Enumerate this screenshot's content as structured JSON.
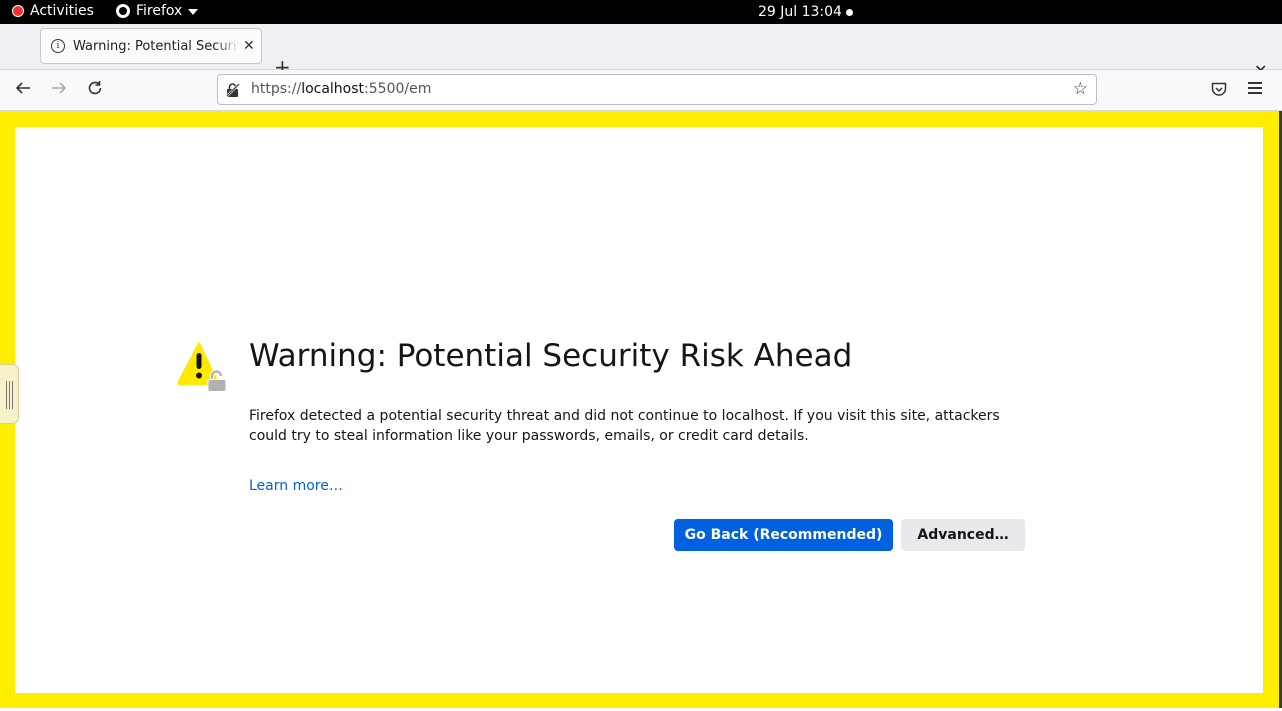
{
  "system_bar": {
    "activities_label": "Activities",
    "app_name": "Firefox",
    "clock": "29 Jul  13:04"
  },
  "tabs": [
    {
      "title": "Warning: Potential Security Risk Ahead",
      "icon": "info-icon",
      "active": true
    }
  ],
  "navbar": {
    "url_scheme": "https://",
    "url_host": "localhost",
    "url_rest": ":5500/em"
  },
  "page": {
    "title": "Warning: Potential Security Risk Ahead",
    "description": "Firefox detected a potential security threat and did not continue to localhost. If you visit this site, attackers could try to steal information like your passwords, emails, or credit card details.",
    "learn_more": "Learn more…",
    "go_back_label": "Go Back (Recommended)",
    "advanced_label": "Advanced…"
  },
  "colors": {
    "frame_border": "#ffee00",
    "primary_button": "#0061e0",
    "link": "#0061e0",
    "warning_icon": "#ffe900"
  }
}
